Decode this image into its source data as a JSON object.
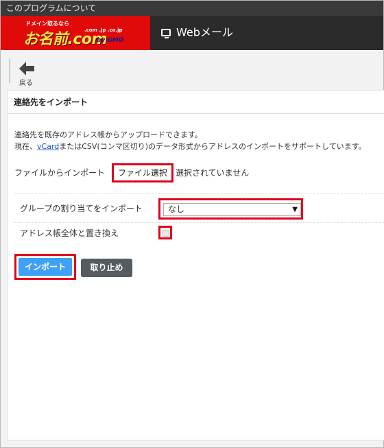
{
  "titlebar": {
    "text": "このプログラムについて"
  },
  "logo": {
    "tagline": "ドメイン取るなら",
    "name": "お名前.com",
    "tlds": ".com .jp .co.jp",
    "brand": "by GMO"
  },
  "header": {
    "app_label": "Webメール",
    "app_icon": "monitor-icon"
  },
  "back": {
    "label": "戻る",
    "icon": "arrow-left-icon"
  },
  "panel": {
    "title": "連絡先をインポート",
    "desc_line1": "連絡先を既存のアドレス帳からアップロードできます。",
    "desc_line2_pre": "現在、",
    "desc_link": "vCard",
    "desc_line2_post": "またはCSV(コンマ区切り)のデータ形式からアドレスのインポートをサポートしています。",
    "file_label": "ファイルからインポート",
    "file_button": "ファイル選択",
    "file_status": "選択されていません",
    "group_label": "グループの割り当てをインポート",
    "group_value": "なし",
    "replace_label": "アドレス帳全体と置き換え",
    "replace_checked": false,
    "import_button": "インポート",
    "cancel_button": "取り止め"
  },
  "colors": {
    "brand_red": "#e10a0a",
    "highlight": "#e1001a",
    "primary": "#3fa1f3",
    "secondary": "#555b60",
    "header_bg": "#2b2b2b"
  }
}
